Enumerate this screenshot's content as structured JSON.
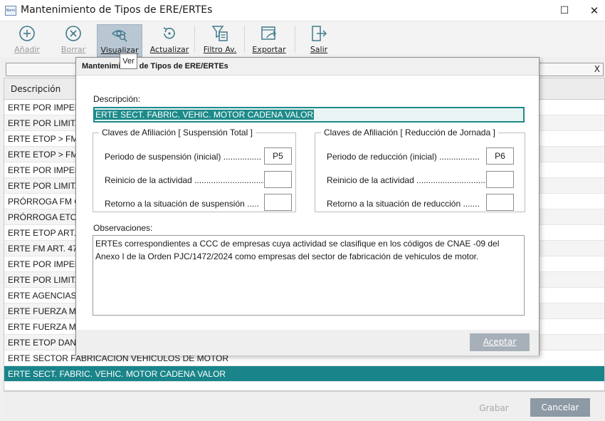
{
  "window": {
    "title": "Mantenimiento de Tipos de ERE/ERTEs",
    "app_icon_text": "Nomi",
    "maximize_glyph": "☐",
    "close_glyph": "✕"
  },
  "toolbar": {
    "add_label": "Añadir",
    "delete_label": "Borrar",
    "view_label": "Visualizar",
    "refresh_label": "Actualizar",
    "filter_label": "Filtro Av.",
    "export_label": "Exportar",
    "exit_label": "Salir",
    "tooltip": "Ver"
  },
  "filter": {
    "clear_glyph": "X"
  },
  "grid": {
    "column_header": "Descripción",
    "rows": [
      "ERTE POR IMPED",
      "ERTE POR LIMITA",
      "ERTE ETOP > FM",
      "ERTE ETOP > FM",
      "ERTE POR IMPED",
      "ERTE POR LIMITA",
      "PRÓRROGA FM C",
      "PRÓRROGA ETOF",
      "ERTE ETOP ART.",
      "ERTE FM ART. 47",
      "ERTE POR IMPED",
      "ERTE POR LIMITA",
      "ERTE AGENCIAS I",
      "ERTE FUERZA MA",
      "ERTE FUERZA MA",
      "ERTE ETOP DANA",
      "ERTE SECTOR FABRICACIÓN VEHÍCULOS DE MOTOR",
      "ERTE SECT. FABRIC. VEHIC. MOTOR CADENA VALOR"
    ],
    "selected_index": 17
  },
  "bottom": {
    "save_label": "Grabar",
    "cancel_label": "Cancelar"
  },
  "modal": {
    "title": "Mantenimiento de Tipos de ERE/ERTEs",
    "description_label": "Descripción:",
    "description_value": "ERTE SECT. FABRIC. VEHIC. MOTOR CADENA VALOR",
    "group_total": {
      "title": "Claves de Afiliación [ Suspensión Total ]",
      "fields": [
        {
          "label": "Periodo de suspensión (inicial) ................",
          "value": "P5"
        },
        {
          "label": "Reinicio de la actividad ..............................",
          "value": ""
        },
        {
          "label": "Retorno a la situación de suspensión .....",
          "value": ""
        }
      ]
    },
    "group_reduction": {
      "title": "Claves de Afiliación [ Reducción de Jornada ]",
      "fields": [
        {
          "label": "Periodo de reducción (inicial) .................",
          "value": "P6"
        },
        {
          "label": "Reinicio de la actividad ..............................",
          "value": ""
        },
        {
          "label": "Retorno a la situación de reducción .......",
          "value": ""
        }
      ]
    },
    "observations_label": "Observaciones:",
    "observations_text": "ERTEs correspondientes a CCC de empresas cuya actividad se clasifique en los códigos de CNAE -09 del Anexo I de la Orden PJC/1472/2024 como empresas del sector de fabricación de vehiculos de motor.",
    "accept_label": "Aceptar"
  },
  "colors": {
    "accent": "#19858a",
    "toolbar_active": "#b9c7d3",
    "button_gray": "#8d99a4",
    "icon_blue": "#3f7b8d"
  }
}
